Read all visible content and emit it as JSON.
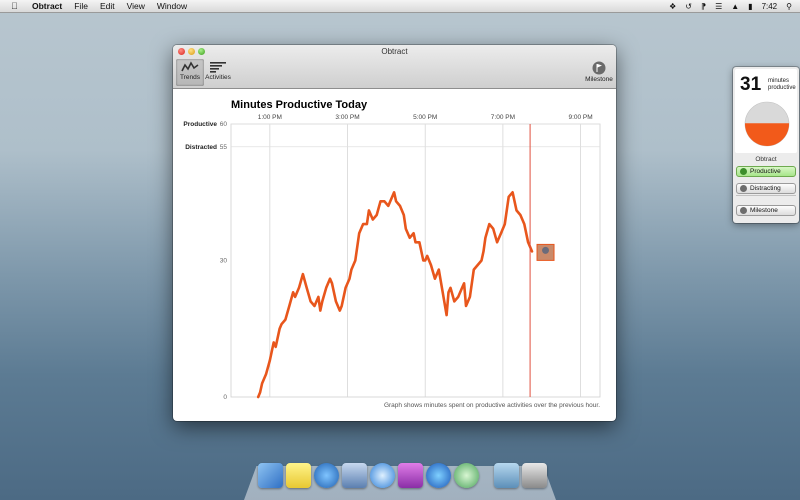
{
  "menubar": {
    "app_name": "Obtract",
    "menus": [
      "File",
      "Edit",
      "View",
      "Window"
    ],
    "clock": "7:42"
  },
  "window": {
    "title": "Obtract",
    "toolbar": {
      "trends_label": "Trends",
      "activities_label": "Activities",
      "milestone_label": "Milestone"
    },
    "footnote": "Graph shows minutes spent on productive activities over the previous hour."
  },
  "chart_data": {
    "type": "line",
    "title": "Minutes Productive Today",
    "x_ticks": [
      "1:00 PM",
      "3:00 PM",
      "5:00 PM",
      "7:00 PM",
      "9:00 PM"
    ],
    "y_reference_labels": [
      {
        "label": "Productive",
        "value": 60
      },
      {
        "label": "Distracted",
        "value": 55
      }
    ],
    "y_ticks": [
      30,
      0
    ],
    "ylim": [
      0,
      60
    ],
    "xlim_hours": [
      12.0,
      21.5
    ],
    "current_time_hours": 19.7,
    "series": [
      {
        "x": [
          12.7,
          12.75,
          12.8,
          12.9,
          13.0,
          13.1,
          13.15,
          13.25,
          13.3,
          13.4,
          13.5,
          13.6,
          13.65,
          13.75,
          13.85,
          13.95,
          14.05,
          14.15,
          14.25,
          14.3,
          14.35,
          14.45,
          14.55,
          14.6,
          14.7,
          14.8,
          14.85,
          14.95,
          15.05,
          15.1,
          15.2,
          15.3,
          15.4,
          15.5,
          15.55,
          15.65,
          15.75,
          15.85,
          15.95,
          16.05,
          16.15,
          16.2,
          16.25,
          16.35,
          16.45,
          16.5,
          16.6,
          16.7,
          16.75,
          16.85,
          16.95,
          17.0,
          17.05,
          17.15,
          17.25,
          17.35,
          17.45,
          17.55,
          17.6,
          17.65,
          17.75,
          17.85,
          17.95,
          18.0,
          18.05,
          18.15,
          18.25,
          18.35,
          18.45,
          18.5,
          18.55,
          18.65,
          18.75,
          18.85,
          18.95,
          19.05,
          19.15,
          19.25,
          19.35,
          19.45,
          19.55,
          19.65,
          19.75
        ],
        "y": [
          0,
          1,
          3,
          5,
          8,
          12,
          11,
          15,
          16,
          17,
          20,
          23,
          22,
          24,
          27,
          24,
          21,
          20,
          22,
          19,
          21,
          24,
          26,
          25,
          21,
          19,
          20,
          24,
          26,
          28,
          30,
          36,
          38,
          38,
          41,
          39,
          40,
          43,
          43,
          42,
          44,
          45,
          43,
          42,
          40,
          37,
          35,
          36,
          34,
          34,
          30,
          30,
          31,
          29,
          26,
          28,
          23,
          18,
          23,
          24,
          21,
          22,
          24,
          25,
          20,
          22,
          28,
          29,
          30,
          32,
          35,
          38,
          37,
          34,
          36,
          38,
          44,
          45,
          41,
          40,
          38,
          34,
          32
        ]
      }
    ]
  },
  "widget": {
    "minutes": "31",
    "minutes_label_line1": "minutes",
    "minutes_label_line2": "productive",
    "productive_fraction": 0.517,
    "header": "Obtract",
    "productive_button": "Productive",
    "distracting_button": "Distracting",
    "milestone_button": "Milestone"
  },
  "colors": {
    "line": "#e8561c",
    "current_time_marker": "#e0503f",
    "widget_active": "#a7e58a"
  }
}
